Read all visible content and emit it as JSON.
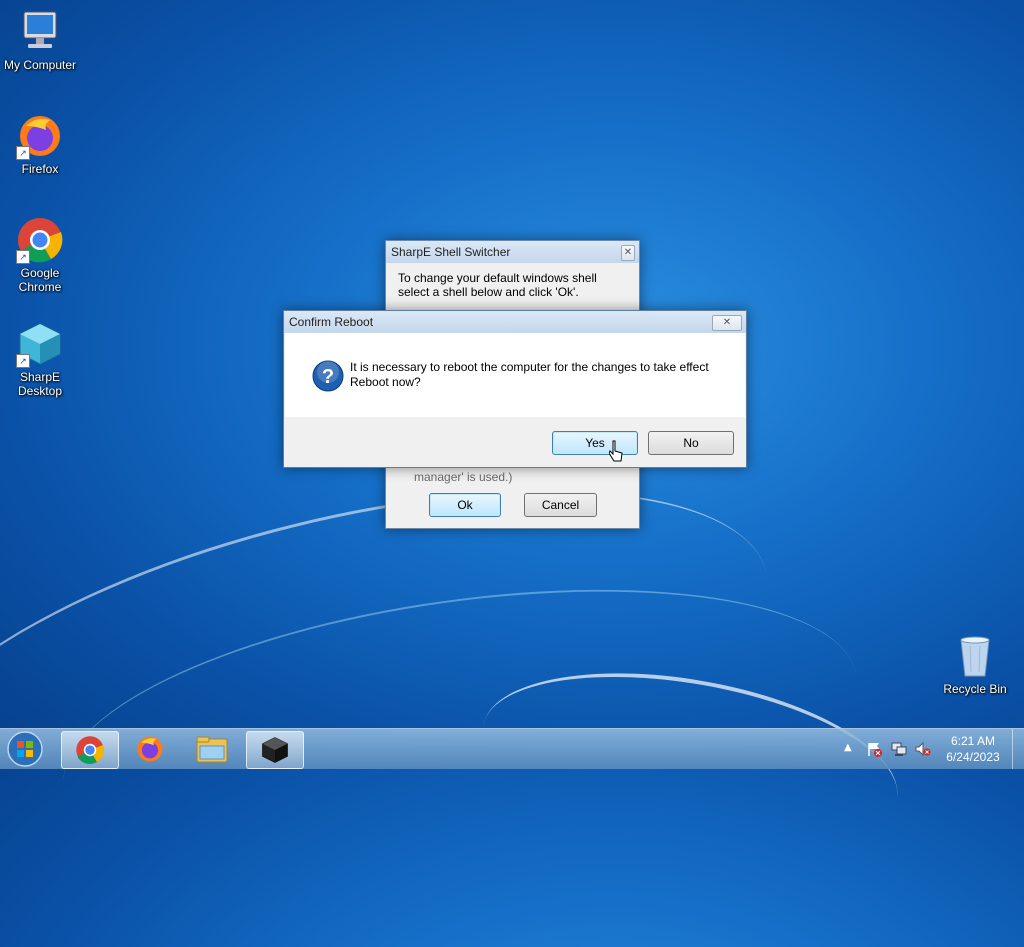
{
  "desktop": {
    "icons": [
      {
        "label": "My Computer"
      },
      {
        "label": "Firefox"
      },
      {
        "label": "Google Chrome"
      },
      {
        "label": "SharpE Desktop"
      },
      {
        "label": "Recycle Bin"
      }
    ]
  },
  "switcher": {
    "title": "SharpE Shell Switcher",
    "instruction": "To change your default windows shell select a shell below and click 'Ok'.",
    "partial_text": "manager' is used.)",
    "ok_label": "Ok",
    "cancel_label": "Cancel"
  },
  "confirm": {
    "title": "Confirm Reboot",
    "message_line1": "It is necessary to reboot the computer for the changes to take effect",
    "message_line2": "Reboot now?",
    "yes_label": "Yes",
    "no_label": "No"
  },
  "taskbar": {
    "items": [
      "start-orb",
      "chrome",
      "firefox",
      "file-explorer",
      "sharpe-desktop"
    ],
    "clock_time": "6:21 AM",
    "clock_date": "6/24/2023"
  },
  "colors": {
    "desktop_bg": "#1670c9",
    "question_icon": "#1f5fb0"
  }
}
